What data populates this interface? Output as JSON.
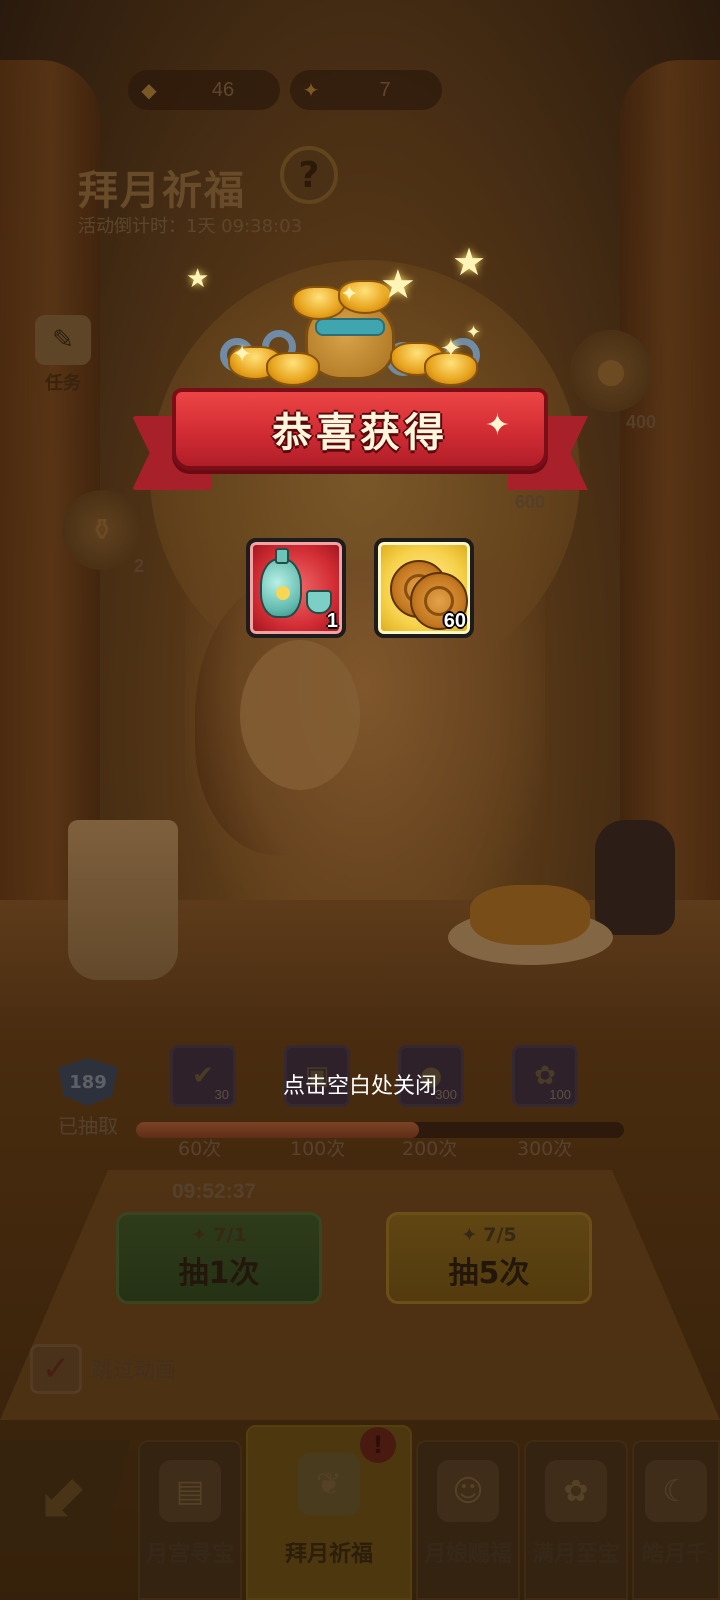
{
  "resources": [
    {
      "icon": "gold-ingot-icon",
      "value": "46"
    },
    {
      "icon": "wish-token-icon",
      "value": "7"
    }
  ],
  "event": {
    "title": "拜月祈福",
    "countdown": "活动倒计时：1天 09:38:03",
    "help_label": "?"
  },
  "task": {
    "label": "任务"
  },
  "reward_nodes": [
    {
      "value": "400"
    },
    {
      "value": "600"
    },
    {
      "value": "2"
    }
  ],
  "progress": {
    "drawn_count": "189",
    "drawn_label": "已抽取",
    "fill_ratio": 0.58,
    "milestones": [
      {
        "count": "30",
        "tick": "60次"
      },
      {
        "count": "",
        "tick": "100次"
      },
      {
        "count": "300",
        "tick": "200次"
      },
      {
        "count": "100",
        "tick": "300次"
      }
    ]
  },
  "draw": {
    "timer": "09:52:37",
    "single": {
      "cost": "7/1",
      "label": "抽1次"
    },
    "multi": {
      "cost": "7/5",
      "label": "抽5次"
    }
  },
  "skip": {
    "label": "跳过动画",
    "checked": true
  },
  "nav": {
    "back_label": "back",
    "tabs": [
      {
        "label": "月宫寻宝",
        "icon": "treasure-chest-icon"
      },
      {
        "label": "拜月祈福",
        "icon": "prayer-incense-icon",
        "active": true,
        "alert": "!"
      },
      {
        "label": "月娘赐福",
        "icon": "moon-lady-icon"
      },
      {
        "label": "满月至宝",
        "icon": "golden-toad-icon"
      },
      {
        "label": "皓月千",
        "icon": "rabbit-icon"
      }
    ]
  },
  "popup": {
    "title": "恭喜获得",
    "rewards": [
      {
        "item": "porcelain-wine-set",
        "count": "1",
        "frame": "red"
      },
      {
        "item": "mooncake",
        "count": "60",
        "frame": "gold"
      }
    ],
    "close_hint": "点击空白处关闭"
  },
  "colors": {
    "banner_red": "#d22c34",
    "epic_frame": "#d22c34",
    "legendary_frame": "#f6d14a"
  }
}
